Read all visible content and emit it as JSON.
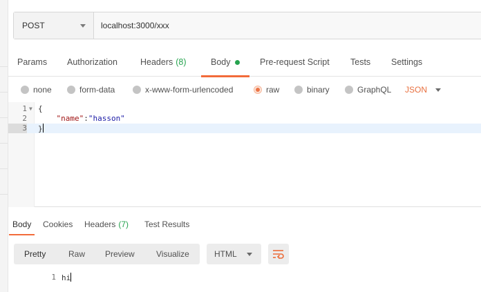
{
  "request": {
    "method": "POST",
    "url": "localhost:3000/xxx"
  },
  "request_tabs": {
    "params": "Params",
    "authorization": "Authorization",
    "headers": "Headers",
    "headers_count": "(8)",
    "body": "Body",
    "pre_request": "Pre-request Script",
    "tests": "Tests",
    "settings": "Settings"
  },
  "body_options": {
    "none": "none",
    "form_data": "form-data",
    "urlencoded": "x-www-form-urlencoded",
    "raw": "raw",
    "binary": "binary",
    "graphql": "GraphQL",
    "format": "JSON",
    "selected": "raw"
  },
  "editor": {
    "lines": [
      {
        "num": "1",
        "text": "{"
      },
      {
        "num": "2",
        "key": "\"name\"",
        "sep": ":",
        "value": "\"hasson\""
      },
      {
        "num": "3",
        "text": "}"
      }
    ]
  },
  "response_tabs": {
    "body": "Body",
    "cookies": "Cookies",
    "headers": "Headers",
    "headers_count": "(7)",
    "test_results": "Test Results"
  },
  "response_view": {
    "pretty": "Pretty",
    "raw": "Raw",
    "preview": "Preview",
    "visualize": "Visualize",
    "format": "HTML"
  },
  "response_body": {
    "line_num": "1",
    "text": "hi"
  },
  "colors": {
    "accent": "#f26b3a",
    "status_green": "#26a34f",
    "json_orange": "#e8703f"
  }
}
